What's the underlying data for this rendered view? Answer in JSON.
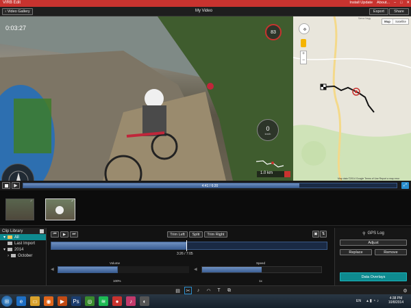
{
  "app": {
    "title": "VIRB Edit",
    "install_update": "Install Update",
    "about": "About...",
    "minimize": "–",
    "maximize": "□",
    "close": "✕"
  },
  "toolbar": {
    "back_label": "Video Gallery",
    "video_title": "My Video",
    "export_label": "Export",
    "share_label": "Share"
  },
  "video": {
    "elapsed": "0:03:27",
    "heart_rate": "83",
    "speed": "0",
    "speed_unit": "km/h",
    "distance": "1.0 km"
  },
  "map": {
    "tab_map": "Map",
    "tab_satellite": "Satellite",
    "attribution": "Map data ©2014 Google   Terms of Use   Report a map error",
    "town_label": "Sarva Nagy"
  },
  "playback": {
    "time": "4:41 / 6:20",
    "progress": 0.74
  },
  "clip_library": {
    "header": "Clip Library",
    "items": [
      "All",
      "Last Import",
      "2014",
      "October"
    ]
  },
  "editor": {
    "trim_left": "Trim Left",
    "split": "Split",
    "trim_right": "Trim Right",
    "clip_time": "3:26 / 7:05",
    "clip_progress": 0.49,
    "volume_label": "Volume",
    "volume_value": "100%",
    "volume_level": 1.0,
    "speed_label": "Speed",
    "speed_value": "1x",
    "speed_level": 0.5
  },
  "gps": {
    "title": "GPS Log",
    "adjust": "Adjust",
    "replace": "Replace",
    "remove": "Remove",
    "data_overlays": "Data Overlays"
  },
  "taskbar": {
    "lang": "EN",
    "time": "4:38 PM",
    "date": "10/8/2014"
  },
  "colors": {
    "brand_red": "#c8332f",
    "accent_teal": "#0e8a8f",
    "track_blue": "#3b5f95"
  }
}
